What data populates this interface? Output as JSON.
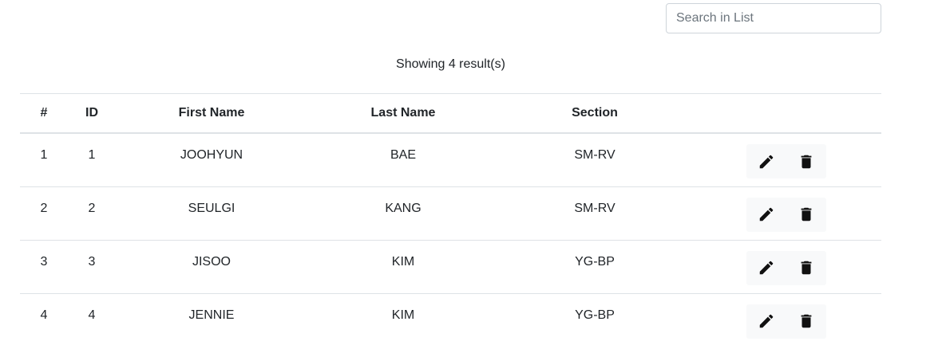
{
  "search": {
    "placeholder": "Search in List",
    "value": ""
  },
  "result_text": "Showing 4 result(s)",
  "table": {
    "headers": [
      "#",
      "ID",
      "First Name",
      "Last Name",
      "Section",
      ""
    ],
    "rows": [
      {
        "num": "1",
        "id": "1",
        "first_name": "JOOHYUN",
        "last_name": "BAE",
        "section": "SM-RV"
      },
      {
        "num": "2",
        "id": "2",
        "first_name": "SEULGI",
        "last_name": "KANG",
        "section": "SM-RV"
      },
      {
        "num": "3",
        "id": "3",
        "first_name": "JISOO",
        "last_name": "KIM",
        "section": "YG-BP"
      },
      {
        "num": "4",
        "id": "4",
        "first_name": "JENNIE",
        "last_name": "KIM",
        "section": "YG-BP"
      }
    ]
  },
  "icons": {
    "edit": "pencil-icon",
    "delete": "trash-icon"
  }
}
